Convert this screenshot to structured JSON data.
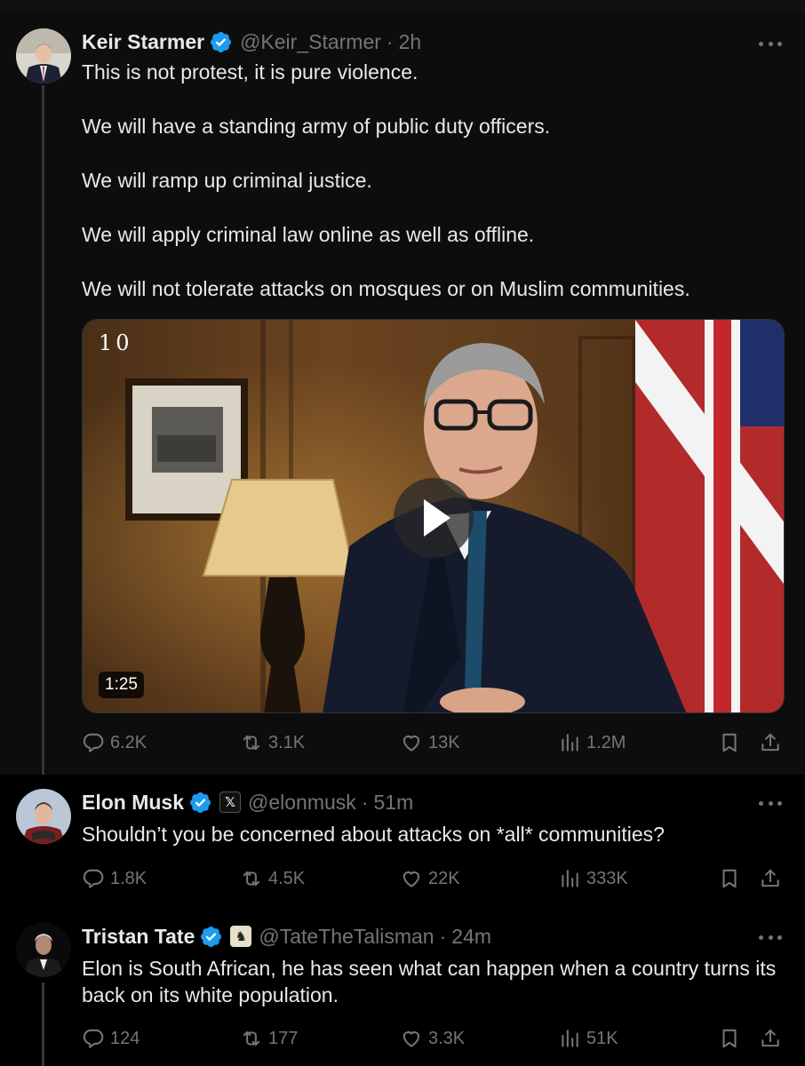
{
  "tweets": [
    {
      "name": "Keir Starmer",
      "handle": "@Keir_Starmer",
      "sep": "·",
      "time": "2h",
      "paragraphs": [
        "This is not protest, it is pure violence.",
        "We will have a standing army of public duty officers.",
        "We will ramp up criminal justice.",
        "We will apply criminal law online as well as offline.",
        "We will not tolerate attacks on mosques or on Muslim communities."
      ],
      "media": {
        "logo": "10",
        "duration": "1:25",
        "play_icon": "play-icon"
      },
      "stats": {
        "replies": "6.2K",
        "reposts": "3.1K",
        "likes": "13K",
        "views": "1.2M"
      }
    },
    {
      "name": "Elon Musk",
      "affiliate": "𝕏",
      "handle": "@elonmusk",
      "sep": "·",
      "time": "51m",
      "text": "Shouldn’t you be concerned about attacks on *all* communities?",
      "stats": {
        "replies": "1.8K",
        "reposts": "4.5K",
        "likes": "22K",
        "views": "333K"
      }
    },
    {
      "name": "Tristan Tate",
      "affiliate": "♞",
      "handle": "@TateTheTalisman",
      "sep": "·",
      "time": "24m",
      "text": "Elon is South African, he has seen what can happen when a country turns its back on its white population.",
      "stats": {
        "replies": "124",
        "reposts": "177",
        "likes": "3.3K",
        "views": "51K"
      }
    }
  ],
  "colors": {
    "verified": "#1d9bf0",
    "muted": "#71767b",
    "text": "#e7e9ea",
    "background": "#000000"
  },
  "icons": [
    "verified-badge-icon",
    "more-icon",
    "reply-icon",
    "repost-icon",
    "like-icon",
    "views-icon",
    "bookmark-icon",
    "share-icon",
    "play-icon"
  ]
}
